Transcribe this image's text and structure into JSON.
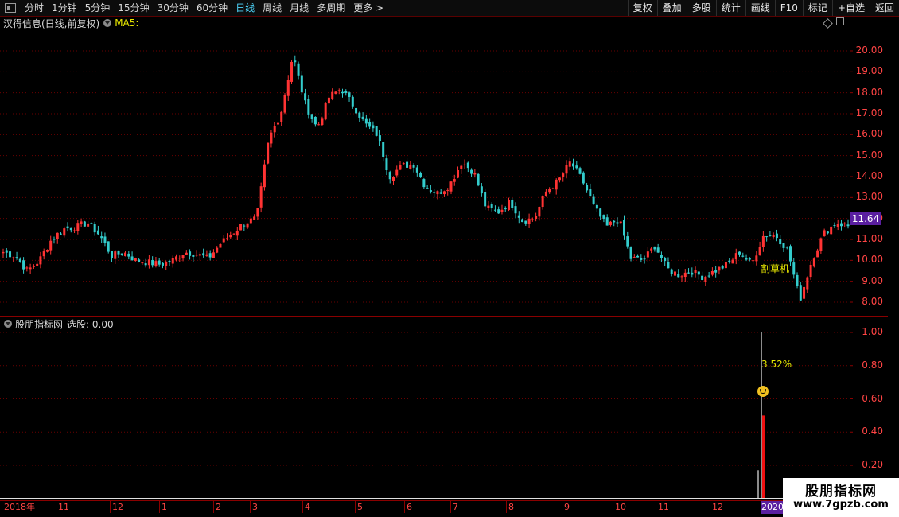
{
  "toolbar": {
    "periods": [
      "分时",
      "1分钟",
      "5分钟",
      "15分钟",
      "30分钟",
      "60分钟",
      "日线",
      "周线",
      "月线",
      "多周期",
      "更多 >"
    ],
    "active_period": "日线",
    "buttons": [
      "复权",
      "叠加",
      "多股",
      "统计",
      "画线",
      "F10",
      "标记",
      "+自选",
      "返回"
    ]
  },
  "main_panel": {
    "stock_title": "汉得信息(日线,前复权)",
    "ma_label": "MA5:",
    "last_price": "11.64",
    "price_ticks": [
      "20.00",
      "19.00",
      "18.00",
      "17.00",
      "16.00",
      "15.00",
      "14.00",
      "13.00",
      "12.00",
      "11.00",
      "10.00",
      "9.00",
      "8.00"
    ],
    "annotation": "割草机"
  },
  "indicator_panel": {
    "title": "股朋指标网",
    "select_label": "选股: 0.00",
    "ticks": [
      "1.00",
      "0.80",
      "0.60",
      "0.40",
      "0.20"
    ],
    "pct_label": "3.52%"
  },
  "x_axis": {
    "labels": [
      "2018年",
      "11",
      "12",
      "1",
      "2",
      "3",
      "4",
      "5",
      "6",
      "7",
      "8",
      "9",
      "10",
      "11",
      "12"
    ],
    "year_label": "2020"
  },
  "watermark": {
    "title": "股朋指标网",
    "url": "www.7gpzb.com"
  },
  "colors": {
    "up": "#ff3333",
    "down": "#33cccc",
    "grid": "#7a0000",
    "accent": "#5a1fa0"
  },
  "chart_data": {
    "type": "candlestick",
    "title": "汉得信息(日线,前复权)",
    "ylim": [
      7.5,
      21.0
    ],
    "approx_closes": [
      10.4,
      10.2,
      9.5,
      10.0,
      11.0,
      11.5,
      11.6,
      11.8,
      11.2,
      10.2,
      10.4,
      10.0,
      9.9,
      9.8,
      10.0,
      10.4,
      10.3,
      10.1,
      10.8,
      11.3,
      11.8,
      12.0,
      15.8,
      17.0,
      19.8,
      17.5,
      16.3,
      17.8,
      18.2,
      17.4,
      16.5,
      16.0,
      14.0,
      14.5,
      14.6,
      13.5,
      13.2,
      13.6,
      14.7,
      14.2,
      12.5,
      12.3,
      12.8,
      11.9,
      12.0,
      13.3,
      13.8,
      14.7,
      13.8,
      12.5,
      11.6,
      12.0,
      10.1,
      10.0,
      10.7,
      9.6,
      9.3,
      9.5,
      9.2,
      9.5,
      9.8,
      10.4,
      9.8,
      11.2,
      11.2,
      10.5,
      8.1,
      10.0,
      11.3,
      11.8,
      11.64
    ]
  }
}
